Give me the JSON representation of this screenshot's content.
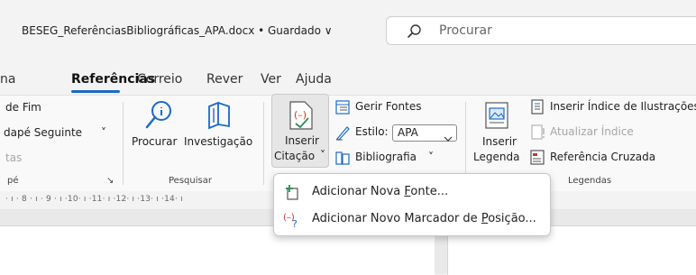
{
  "title_bar": {
    "doc_title": "BESEG_ReferênciasBibliográficas_APA.docx • Guardado ∨",
    "search_placeholder": "Procurar"
  },
  "tabs": [
    {
      "label": "na"
    },
    {
      "label": "Referências",
      "active": true
    },
    {
      "label": "Correio"
    },
    {
      "label": "Rever"
    },
    {
      "label": "Ver"
    },
    {
      "label": "Ajuda"
    }
  ],
  "ribbon": {
    "footnotes": {
      "item1": "de Fim",
      "item2": "dapé Seguinte",
      "item2_chevron": "˅",
      "item3": "tas",
      "group_label": "pé",
      "launcher": "↘"
    },
    "research": {
      "search_label": "Procurar",
      "research_label": "Investigação",
      "group_label": "Pesquisar"
    },
    "citations": {
      "insert_citation_line1": "Inserir",
      "insert_citation_line2": "Citação",
      "insert_citation_chevron": "˅",
      "manage_sources": "Gerir Fontes",
      "style_label": "Estilo:",
      "style_value": "APA",
      "bibliography": "Bibliografia",
      "bibliography_chevron": "˅"
    },
    "captions": {
      "insert_caption_line1": "Inserir",
      "insert_caption_line2": "Legenda",
      "insert_table_of_figures": "Inserir Índice de Ilustrações",
      "update_table": "Atualizar Índice",
      "cross_reference": "Referência Cruzada",
      "group_label": "Legendas"
    }
  },
  "ruler": {
    "text": "· ı · 8 · ı · 9 · ı ·10· ı ·11· ı ·12· ı ·13· ı ·14· ı"
  },
  "dropdown": {
    "items": [
      {
        "label_pre": "Adicionar Nova ",
        "label_u": "F",
        "label_post": "onte..."
      },
      {
        "label_pre": "Adicionar Novo Marcador de ",
        "label_u": "P",
        "label_post": "osição..."
      }
    ]
  },
  "colors": {
    "accent": "#1b6ac9",
    "citation_red": "#c0392b",
    "icon_green": "#2e8b57"
  }
}
